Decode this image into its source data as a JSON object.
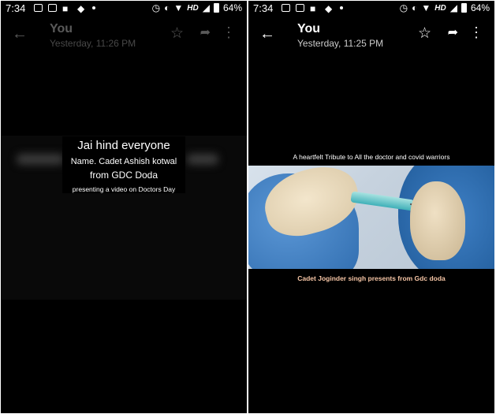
{
  "left_screen": {
    "status_bar": {
      "time": "7:34",
      "network": "HD",
      "battery": "64%"
    },
    "header": {
      "sender": "You",
      "timestamp": "Yesterday, 11:26 PM"
    },
    "video": {
      "line1": "Jai hind everyone",
      "line2": "Name.   Cadet Ashish kotwal",
      "line3": "from GDC Doda",
      "line4": "presenting a video on Doctors Day"
    }
  },
  "right_screen": {
    "status_bar": {
      "time": "7:34",
      "network": "HD",
      "battery": "64%"
    },
    "header": {
      "sender": "You",
      "timestamp": "Yesterday, 11:25 PM"
    },
    "video": {
      "tribute": "A heartfelt Tribute to All the doctor and covid warriors",
      "caption": "Cadet Joginder singh presents from Gdc doda"
    }
  },
  "icons": {
    "back": "arrow-back-icon",
    "star": "star-outline-icon",
    "forward": "forward-icon",
    "more": "more-vert-icon"
  },
  "colors": {
    "background": "#000000",
    "caption": "#f7c6a6"
  }
}
